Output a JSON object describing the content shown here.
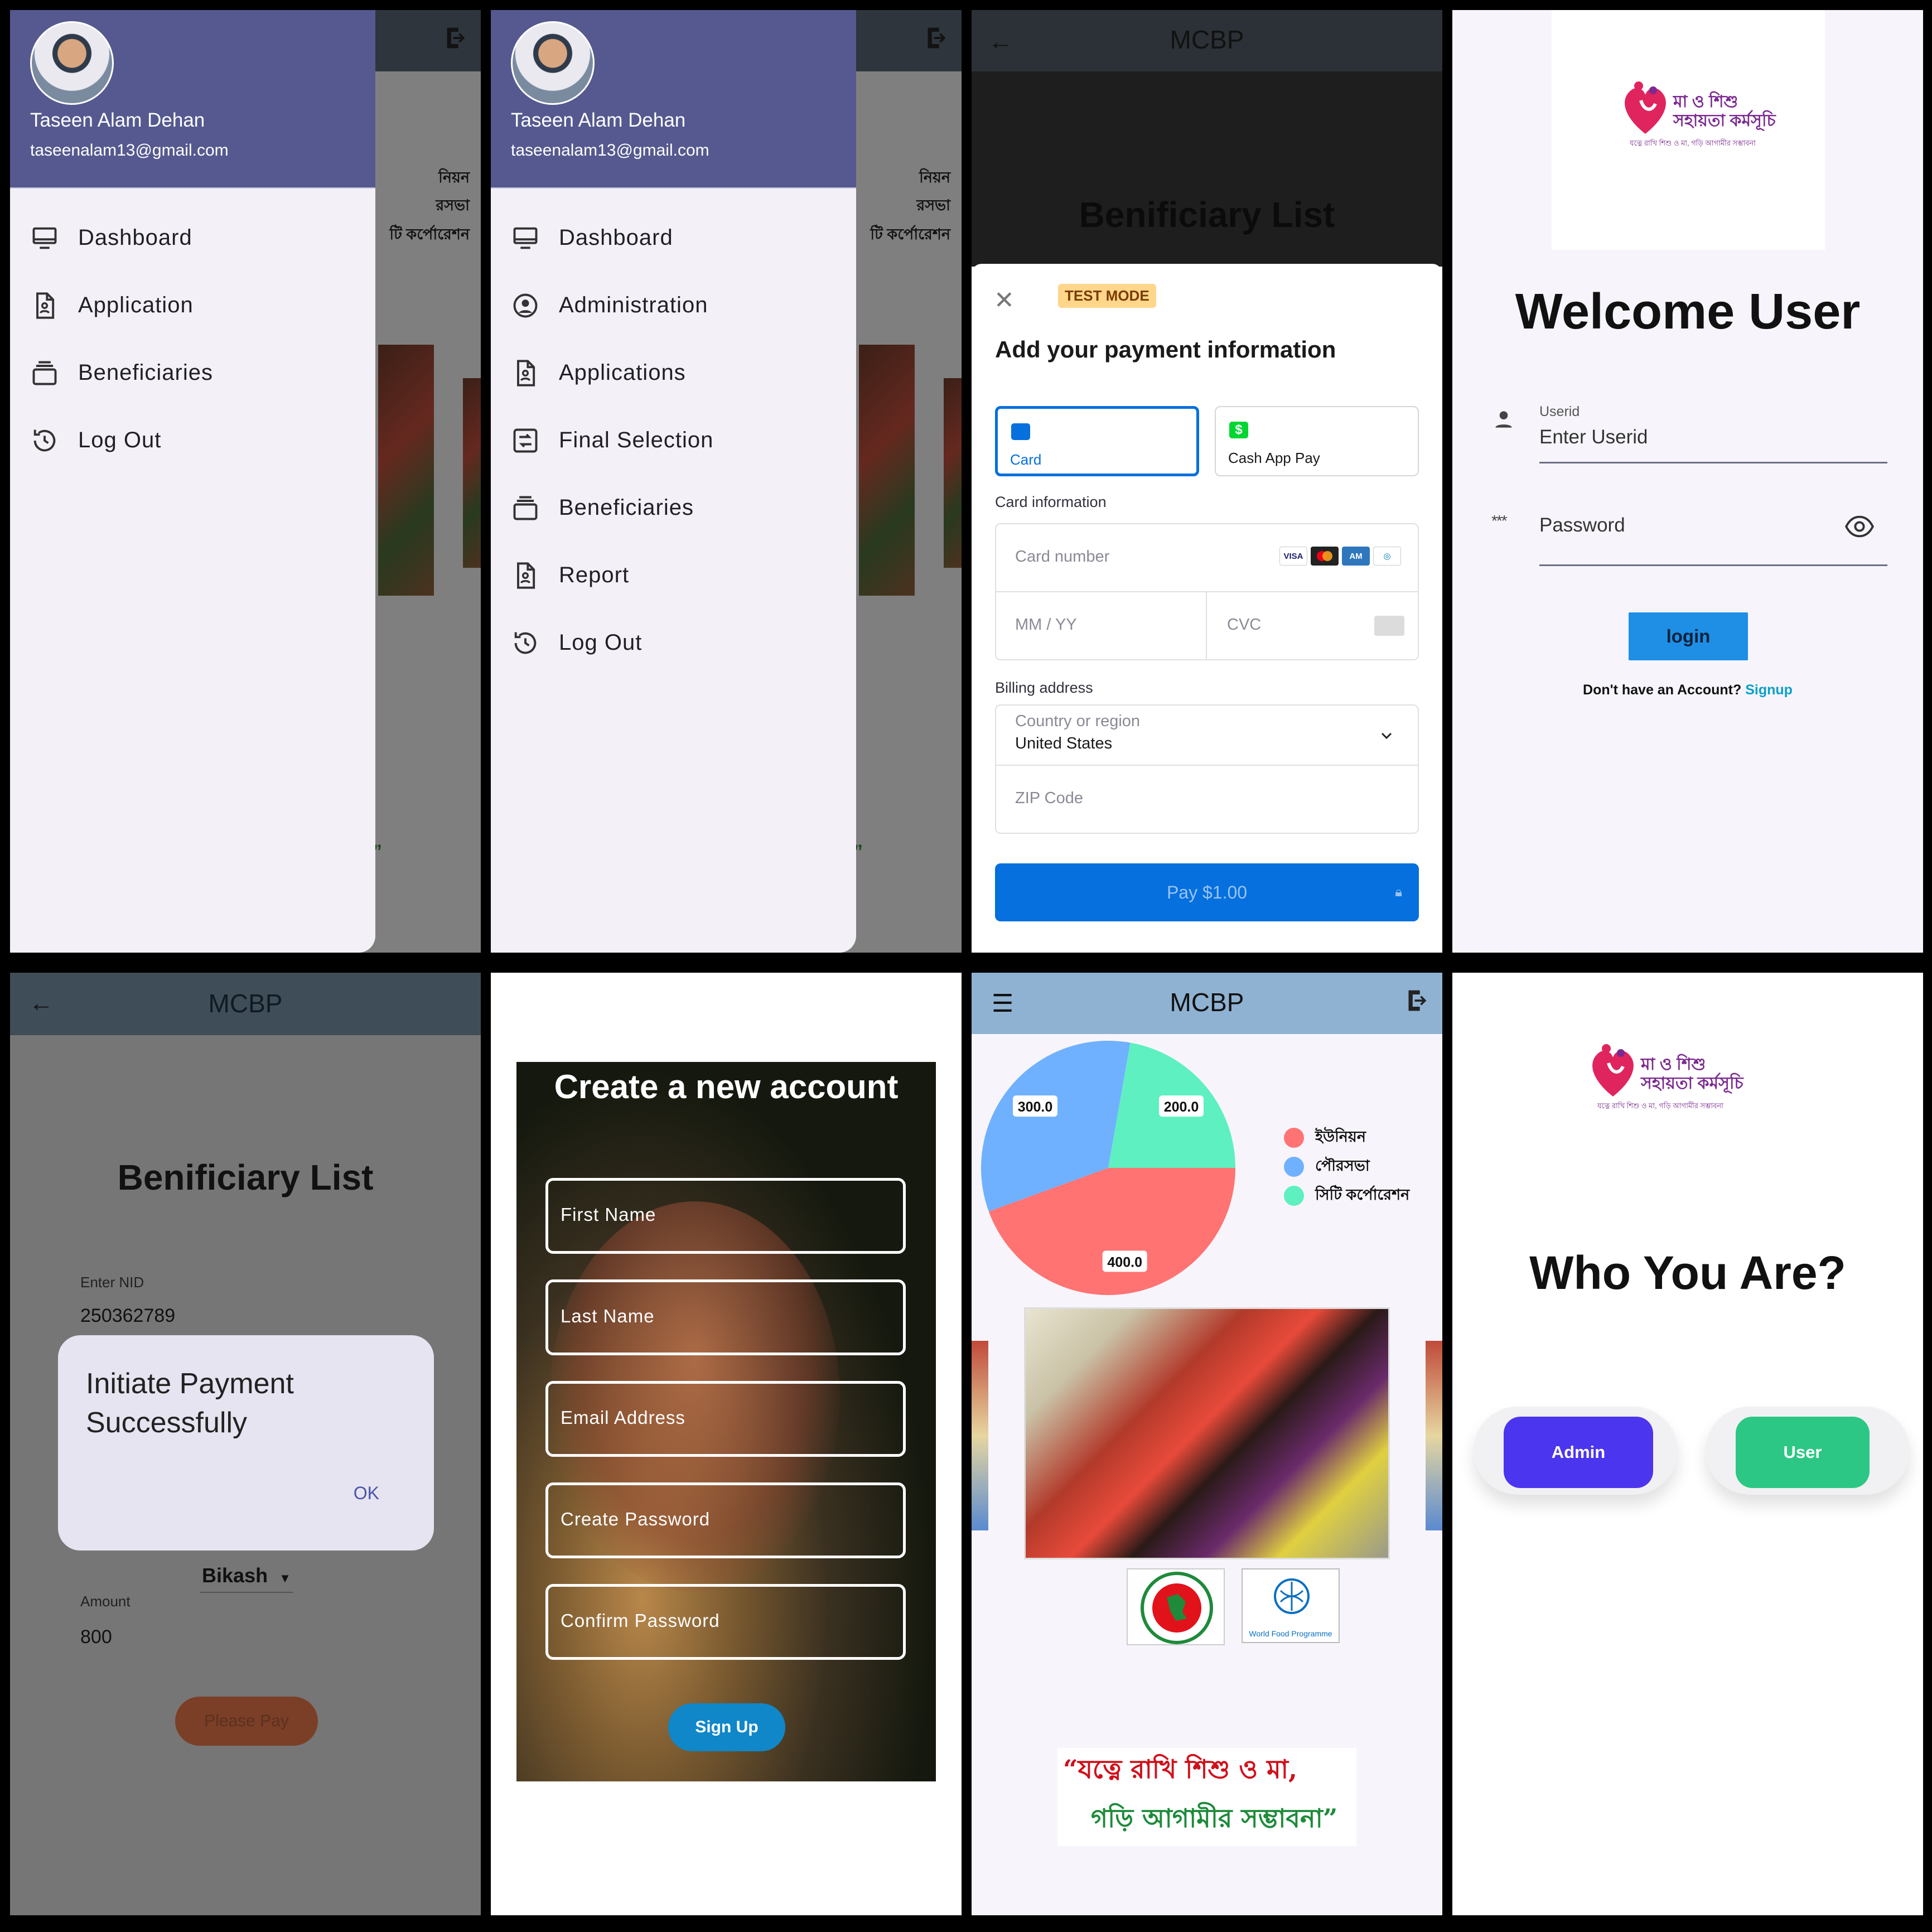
{
  "drawer_user": {
    "name": "Taseen Alam Dehan",
    "email": "taseenalam13@gmail.com"
  },
  "bg_texts": [
    "নিয়ন",
    "রসভা",
    "টি কর্পোরেশন"
  ],
  "bg_quote": "”",
  "drawer1": {
    "items": [
      {
        "icon": "monitor-icon",
        "label": "Dashboard"
      },
      {
        "icon": "document-icon",
        "label": "Application"
      },
      {
        "icon": "stack-icon",
        "label": "Beneficiaries"
      },
      {
        "icon": "history-icon",
        "label": "Log Out"
      }
    ]
  },
  "drawer2": {
    "items": [
      {
        "icon": "monitor-icon",
        "label": "Dashboard"
      },
      {
        "icon": "account-circle-icon",
        "label": "Administration"
      },
      {
        "icon": "document-icon",
        "label": "Applications"
      },
      {
        "icon": "selection-icon",
        "label": "Final Selection"
      },
      {
        "icon": "stack-icon",
        "label": "Beneficiaries"
      },
      {
        "icon": "report-icon",
        "label": "Report"
      },
      {
        "icon": "history-icon",
        "label": "Log Out"
      }
    ]
  },
  "payment": {
    "app_title": "MCBP",
    "list_title": "Benificiary List",
    "test_mode": "TEST MODE",
    "heading": "Add your payment information",
    "methods": [
      {
        "label": "Card",
        "selected": true
      },
      {
        "label": "Cash App Pay",
        "selected": false
      }
    ],
    "card_info_label": "Card information",
    "card_number_placeholder": "Card number",
    "card_brands": [
      "VISA",
      "Mastercard",
      "Amex",
      "Diners"
    ],
    "expiry_placeholder": "MM / YY",
    "cvc_placeholder": "CVC",
    "billing_label": "Billing address",
    "country_label": "Country or region",
    "country_value": "United States",
    "zip_placeholder": "ZIP Code",
    "pay_button": "Pay $1.00",
    "accent_color": "#0570de"
  },
  "login": {
    "logo": {
      "line1": "মা ও শিশু",
      "line2": "সহায়তা কর্মসূচি",
      "tagline": "যত্নে রাখি শিশু ও মা, গড়ি আগামীর সম্ভাবনা"
    },
    "welcome": "Welcome User",
    "userid_label": "Userid",
    "userid_placeholder": "Enter Userid",
    "password_placeholder": "Password",
    "login_button": "login",
    "no_account": "Don't have an Account?",
    "signup_link": "Signup"
  },
  "beneficiary": {
    "app_title": "MCBP",
    "list_title": "Benificiary List",
    "nid_label": "Enter NID",
    "nid_value": "250362789",
    "dialog_text": "Initiate Payment Successfully",
    "dialog_ok": "OK",
    "method_value": "Bikash",
    "amount_label": "Amount",
    "amount_value": "800",
    "pay_button": "Please Pay"
  },
  "signup": {
    "title": "Create a new account",
    "fields": [
      "First Name",
      "Last Name",
      "Email Address",
      "Create Password",
      "Confirm Password"
    ],
    "button": "Sign Up"
  },
  "dashboard": {
    "app_title": "MCBP",
    "legend": [
      {
        "label": "ইউনিয়ন",
        "color": "#ff7373"
      },
      {
        "label": "পৌরসভা",
        "color": "#6fb1ff"
      },
      {
        "label": "সিটি কর্পোরেশন",
        "color": "#5ef0c0"
      }
    ],
    "wfp_label": "World Food Programme",
    "slogan_line1": "“যত্নে রাখি শিশু ও মা,",
    "slogan_line2": "গড়ি আগামীর সম্ভাবনা”"
  },
  "chart_data": {
    "type": "pie",
    "categories": [
      "ইউনিয়ন",
      "পৌরসভা",
      "সিটি কর্পোরেশন"
    ],
    "values": [
      400.0,
      300.0,
      200.0
    ],
    "value_labels": [
      "400.0",
      "300.0",
      "200.0"
    ],
    "colors": [
      "#ff7373",
      "#6fb1ff",
      "#5ef0c0"
    ],
    "legend": "right"
  },
  "roles": {
    "title": "Who You Are?",
    "admin": "Admin",
    "user": "User",
    "admin_color": "#4b35ee",
    "user_color": "#2cc784"
  }
}
